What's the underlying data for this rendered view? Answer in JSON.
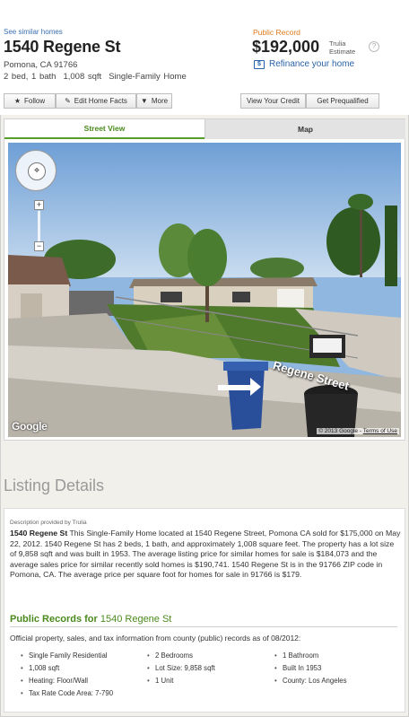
{
  "header": {
    "similar_link": "See similar homes",
    "address": "1540 Regene St",
    "city": "Pomona, CA 91766",
    "beds_baths": "2 bed, 1 bath",
    "sqft": "1,008 sqft",
    "type": "Single-Family Home",
    "public_record_label": "Public Record",
    "price": "$192,000",
    "estimate_line1": "Trulia",
    "estimate_line2": "Estimate",
    "help_glyph": "?",
    "refinance_link": "Refinance your home"
  },
  "actions": {
    "follow": "Follow",
    "edit": "Edit Home Facts",
    "more": "More",
    "view_credit": "View Your Credit",
    "prequalified": "Get Prequalified"
  },
  "tabs": {
    "street_view": "Street View",
    "map": "Map"
  },
  "street_view": {
    "street_label": "Regene Street",
    "google": "Google",
    "copyright": "© 2013 Google",
    "terms": "Terms of Use"
  },
  "listing": {
    "heading": "Listing Details",
    "source": "Description provided by Trulia",
    "desc_address": "1540 Regene St",
    "description": " This Single-Family Home located at 1540 Regene Street, Pomona CA sold for $175,000 on May 22, 2012. 1540 Regene St has 2 beds, 1 bath, and approximately 1,008 square feet. The property has a lot size of 9,858 sqft and was built in 1953. The average listing price for similar homes for sale is $184,073 and the average sales price for similar recently sold homes is $190,741. 1540 Regene St is in the 91766 ZIP code in Pomona, CA. The average price per square foot for homes for sale in 91766 is $179.",
    "records_heading": "Public Records for",
    "records_address": "1540 Regene St",
    "records_intro": "Official property, sales, and tax information from county (public) records as of 08/2012:",
    "attributes": [
      "Single Family Residential",
      "2 Bedrooms",
      "1 Bathroom",
      "1,008 sqft",
      "Lot Size: 9,858 sqft",
      "Built In 1953",
      "Heating: Floor/Wall",
      "1 Unit",
      "County: Los Angeles",
      "Tax Rate Code Area: 7-790"
    ]
  },
  "colors": {
    "link_blue": "#3a6fb0",
    "accent_green": "#4a8a1c",
    "public_record_orange": "#e07b1c"
  }
}
